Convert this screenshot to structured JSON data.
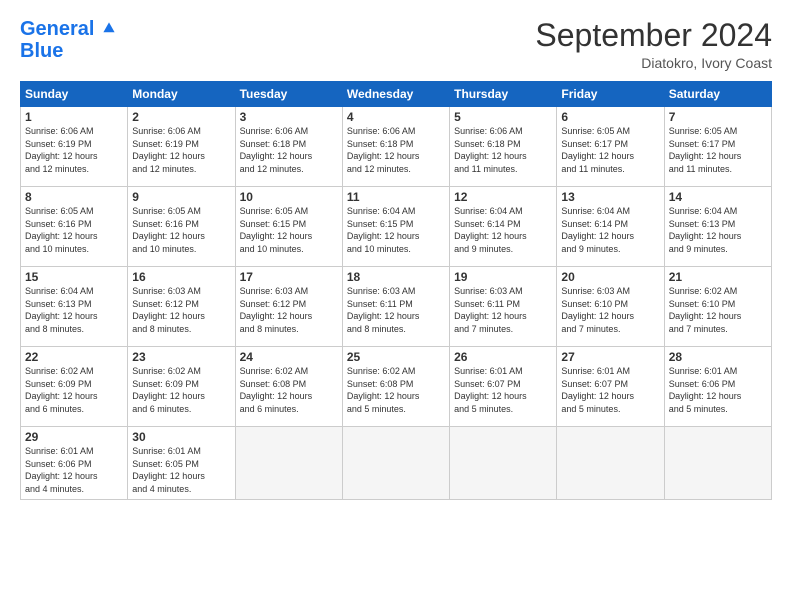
{
  "header": {
    "logo_line1": "General",
    "logo_line2": "Blue",
    "month": "September 2024",
    "location": "Diatokro, Ivory Coast"
  },
  "weekdays": [
    "Sunday",
    "Monday",
    "Tuesday",
    "Wednesday",
    "Thursday",
    "Friday",
    "Saturday"
  ],
  "weeks": [
    [
      {
        "day": "1",
        "info": "Sunrise: 6:06 AM\nSunset: 6:19 PM\nDaylight: 12 hours\nand 12 minutes."
      },
      {
        "day": "2",
        "info": "Sunrise: 6:06 AM\nSunset: 6:19 PM\nDaylight: 12 hours\nand 12 minutes."
      },
      {
        "day": "3",
        "info": "Sunrise: 6:06 AM\nSunset: 6:18 PM\nDaylight: 12 hours\nand 12 minutes."
      },
      {
        "day": "4",
        "info": "Sunrise: 6:06 AM\nSunset: 6:18 PM\nDaylight: 12 hours\nand 12 minutes."
      },
      {
        "day": "5",
        "info": "Sunrise: 6:06 AM\nSunset: 6:18 PM\nDaylight: 12 hours\nand 11 minutes."
      },
      {
        "day": "6",
        "info": "Sunrise: 6:05 AM\nSunset: 6:17 PM\nDaylight: 12 hours\nand 11 minutes."
      },
      {
        "day": "7",
        "info": "Sunrise: 6:05 AM\nSunset: 6:17 PM\nDaylight: 12 hours\nand 11 minutes."
      }
    ],
    [
      {
        "day": "8",
        "info": "Sunrise: 6:05 AM\nSunset: 6:16 PM\nDaylight: 12 hours\nand 10 minutes."
      },
      {
        "day": "9",
        "info": "Sunrise: 6:05 AM\nSunset: 6:16 PM\nDaylight: 12 hours\nand 10 minutes."
      },
      {
        "day": "10",
        "info": "Sunrise: 6:05 AM\nSunset: 6:15 PM\nDaylight: 12 hours\nand 10 minutes."
      },
      {
        "day": "11",
        "info": "Sunrise: 6:04 AM\nSunset: 6:15 PM\nDaylight: 12 hours\nand 10 minutes."
      },
      {
        "day": "12",
        "info": "Sunrise: 6:04 AM\nSunset: 6:14 PM\nDaylight: 12 hours\nand 9 minutes."
      },
      {
        "day": "13",
        "info": "Sunrise: 6:04 AM\nSunset: 6:14 PM\nDaylight: 12 hours\nand 9 minutes."
      },
      {
        "day": "14",
        "info": "Sunrise: 6:04 AM\nSunset: 6:13 PM\nDaylight: 12 hours\nand 9 minutes."
      }
    ],
    [
      {
        "day": "15",
        "info": "Sunrise: 6:04 AM\nSunset: 6:13 PM\nDaylight: 12 hours\nand 8 minutes."
      },
      {
        "day": "16",
        "info": "Sunrise: 6:03 AM\nSunset: 6:12 PM\nDaylight: 12 hours\nand 8 minutes."
      },
      {
        "day": "17",
        "info": "Sunrise: 6:03 AM\nSunset: 6:12 PM\nDaylight: 12 hours\nand 8 minutes."
      },
      {
        "day": "18",
        "info": "Sunrise: 6:03 AM\nSunset: 6:11 PM\nDaylight: 12 hours\nand 8 minutes."
      },
      {
        "day": "19",
        "info": "Sunrise: 6:03 AM\nSunset: 6:11 PM\nDaylight: 12 hours\nand 7 minutes."
      },
      {
        "day": "20",
        "info": "Sunrise: 6:03 AM\nSunset: 6:10 PM\nDaylight: 12 hours\nand 7 minutes."
      },
      {
        "day": "21",
        "info": "Sunrise: 6:02 AM\nSunset: 6:10 PM\nDaylight: 12 hours\nand 7 minutes."
      }
    ],
    [
      {
        "day": "22",
        "info": "Sunrise: 6:02 AM\nSunset: 6:09 PM\nDaylight: 12 hours\nand 6 minutes."
      },
      {
        "day": "23",
        "info": "Sunrise: 6:02 AM\nSunset: 6:09 PM\nDaylight: 12 hours\nand 6 minutes."
      },
      {
        "day": "24",
        "info": "Sunrise: 6:02 AM\nSunset: 6:08 PM\nDaylight: 12 hours\nand 6 minutes."
      },
      {
        "day": "25",
        "info": "Sunrise: 6:02 AM\nSunset: 6:08 PM\nDaylight: 12 hours\nand 5 minutes."
      },
      {
        "day": "26",
        "info": "Sunrise: 6:01 AM\nSunset: 6:07 PM\nDaylight: 12 hours\nand 5 minutes."
      },
      {
        "day": "27",
        "info": "Sunrise: 6:01 AM\nSunset: 6:07 PM\nDaylight: 12 hours\nand 5 minutes."
      },
      {
        "day": "28",
        "info": "Sunrise: 6:01 AM\nSunset: 6:06 PM\nDaylight: 12 hours\nand 5 minutes."
      }
    ],
    [
      {
        "day": "29",
        "info": "Sunrise: 6:01 AM\nSunset: 6:06 PM\nDaylight: 12 hours\nand 4 minutes."
      },
      {
        "day": "30",
        "info": "Sunrise: 6:01 AM\nSunset: 6:05 PM\nDaylight: 12 hours\nand 4 minutes."
      },
      {
        "day": "",
        "info": ""
      },
      {
        "day": "",
        "info": ""
      },
      {
        "day": "",
        "info": ""
      },
      {
        "day": "",
        "info": ""
      },
      {
        "day": "",
        "info": ""
      }
    ]
  ]
}
